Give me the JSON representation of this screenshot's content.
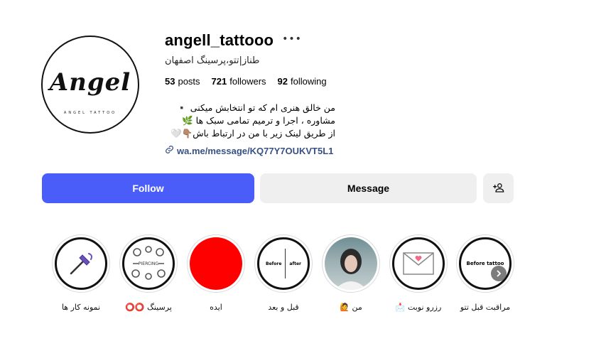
{
  "profile": {
    "username": "angell_tattooo",
    "more_icon": "more-horizontal-icon",
    "full_name": "طناز|تتو،پرسینگ اصفهان",
    "avatar_text": "Angel",
    "avatar_subtext": "ANGEL TATTOO"
  },
  "stats": {
    "posts_count": "53",
    "posts_label": "posts",
    "followers_count": "721",
    "followers_label": "followers",
    "following_count": "92",
    "following_label": "following"
  },
  "bio": {
    "lines": [
      "من خالق هنری ام که تو انتخابش میکنی ▪️",
      "مشاوره ، اجرا و ترمیم تمامی سبک ها 🌿",
      "از طریق لینک زیر با من در ارتباط باش👇🏽🤍"
    ],
    "link_text": "wa.me/message/KQ77Y7OUKVT5L1",
    "link_icon": "link-icon"
  },
  "actions": {
    "follow_label": "Follow",
    "message_label": "Message",
    "suggest_icon": "add-person-icon",
    "follow_color": "#4a5df9"
  },
  "highlights": [
    {
      "label": "مراقبت قبل تتو",
      "cover_text": "Before tattoo"
    },
    {
      "label": "رزرو نوبت 📩"
    },
    {
      "label": "من 🙋"
    },
    {
      "label": "قبل و بعد",
      "cover_left": "Before",
      "cover_right": "after"
    },
    {
      "label": "ایده",
      "cover_color": "#ff0000"
    },
    {
      "label": "پرسینگ ⭕⭕",
      "cover_text": "PIERCING"
    },
    {
      "label": "نمونه کار ها"
    }
  ],
  "carousel": {
    "next_icon": "chevron-right-icon"
  }
}
